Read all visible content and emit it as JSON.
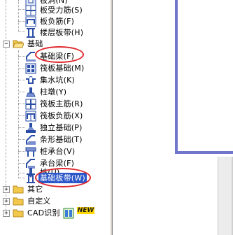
{
  "tree": {
    "items": [
      {
        "label": "板洞(N)",
        "icon": "slab-hole-icon"
      },
      {
        "label": "板受力筋(S)",
        "icon": "slab-rebar-icon"
      },
      {
        "label": "板负筋(F)",
        "icon": "slab-negative-rebar-icon"
      },
      {
        "label": "楼层板带(H)",
        "icon": "floor-strip-icon"
      }
    ],
    "group_foundation": {
      "label": "基础",
      "expanded": true
    },
    "foundation_items": [
      {
        "label": "基础梁(F)",
        "icon": "foundation-beam-icon",
        "annotated": true
      },
      {
        "label": "筏板基础(M)",
        "icon": "raft-foundation-icon"
      },
      {
        "label": "集水坑(K)",
        "icon": "sump-pit-icon"
      },
      {
        "label": "柱墩(Y)",
        "icon": "column-pier-icon"
      },
      {
        "label": "筏板主筋(R)",
        "icon": "raft-main-rebar-icon"
      },
      {
        "label": "筏板负筋(X)",
        "icon": "raft-negative-rebar-icon"
      },
      {
        "label": "独立基础(P)",
        "icon": "isolated-footing-icon"
      },
      {
        "label": "条形基础(T)",
        "icon": "strip-footing-icon"
      },
      {
        "label": "桩承台(V)",
        "icon": "pile-cap-icon"
      },
      {
        "label": "承台梁(F)",
        "icon": "cap-beam-icon"
      },
      {
        "label": "桩(U)",
        "icon": "pile-icon"
      },
      {
        "label": "基础板带(W)",
        "icon": "foundation-strip-icon",
        "selected": true,
        "annotated": true
      }
    ],
    "groups_collapsed": [
      {
        "label": "其它"
      },
      {
        "label": "自定义"
      },
      {
        "label": "CAD识别",
        "badge": "NEW"
      }
    ]
  },
  "colors": {
    "selection": "#2b57c9",
    "annotation": "#e0282e",
    "frame": "#6f76cc",
    "folder": "#f2c94c"
  }
}
